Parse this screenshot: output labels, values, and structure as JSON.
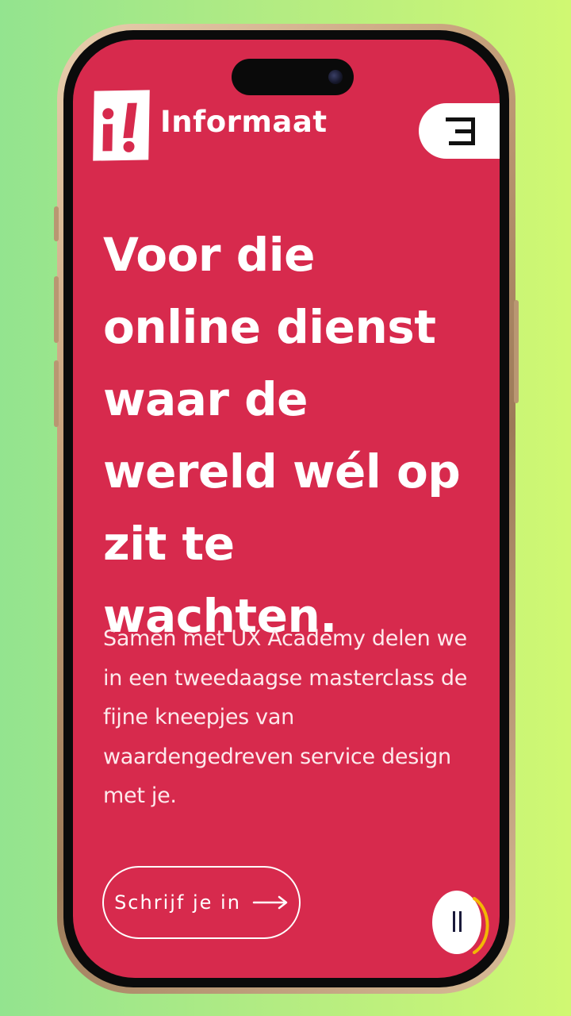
{
  "brand": {
    "name": "Informaat"
  },
  "hero": {
    "headline": "Voor die online dienst waar de wereld wél op zit te wachten.",
    "intro": "Samen met UX Academy delen we in een tweedaagse masterclass de fijne kneepjes van waardengedreven service design met je."
  },
  "cta": {
    "label": "Schrijf je in",
    "icon": "arrow-right-icon"
  },
  "controls": {
    "menu_icon": "hamburger-menu-icon",
    "pause_icon": "pause-icon"
  },
  "colors": {
    "background_left": "#93e48f",
    "background_right": "#d0f872",
    "screen": "#d72a4d",
    "text": "#ffffff",
    "progress": "#f2b705"
  }
}
